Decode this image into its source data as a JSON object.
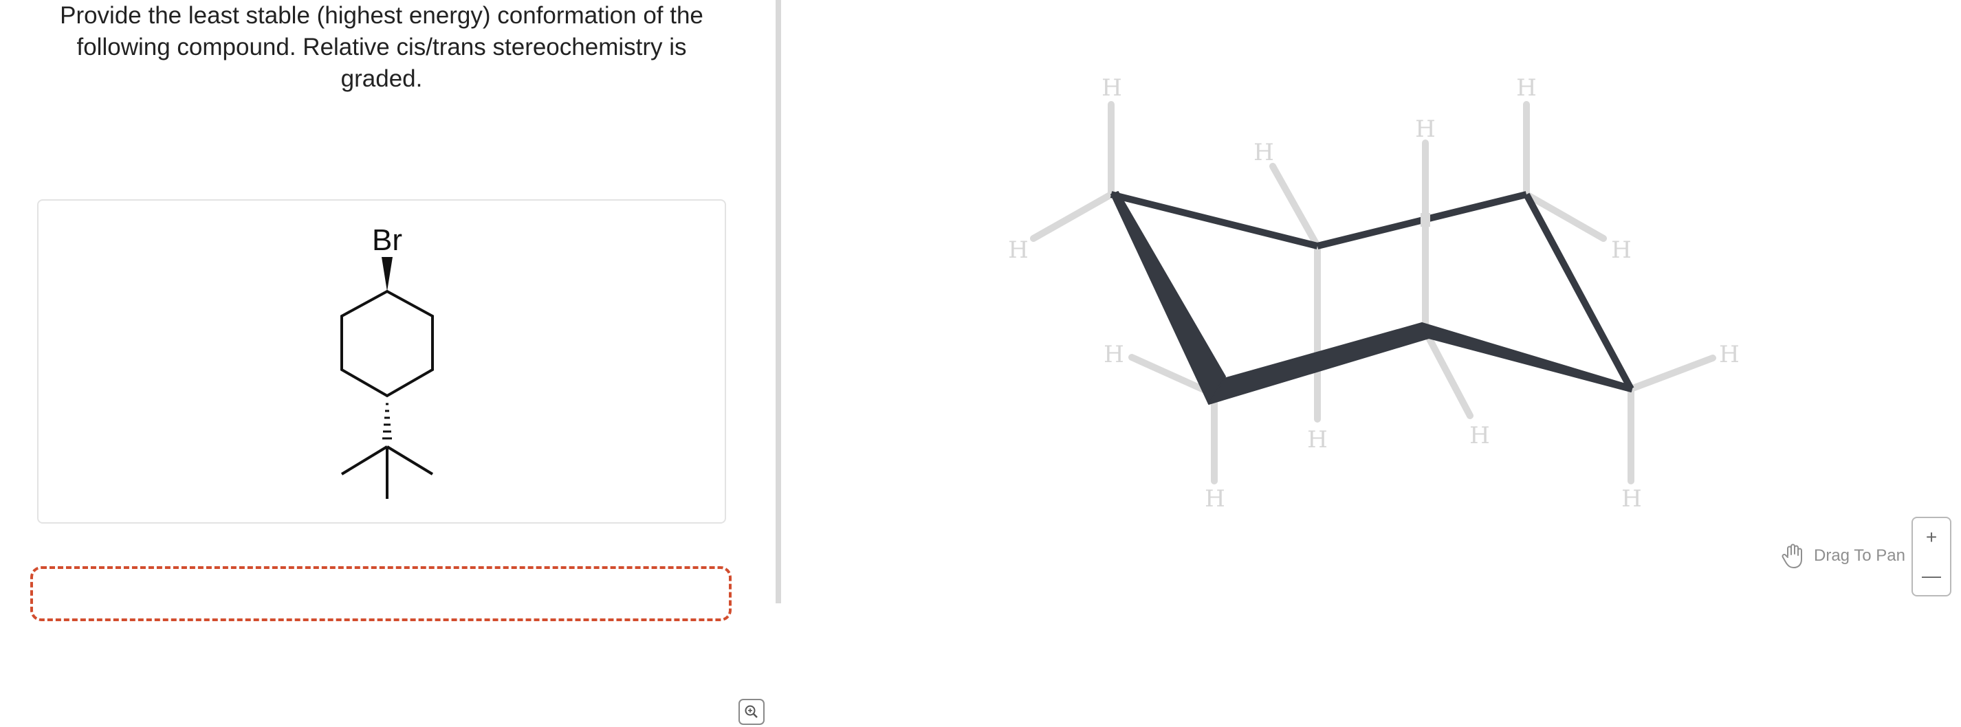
{
  "question": {
    "line1": "Provide the least stable (highest energy) conformation of the",
    "line2": "following compound. Relative cis/trans stereochemistry is",
    "line3": "graded."
  },
  "structure": {
    "substituent_label": "Br",
    "zoom_icon": "magnifier-icon"
  },
  "chair": {
    "h_label": "H",
    "bond_color": "#363a42",
    "hydrogen_color": "#d9d9d9"
  },
  "canvas_controls": {
    "pan_label": "Drag To Pan",
    "pan_icon": "hand-icon",
    "zoom_in": "+",
    "zoom_out": "—"
  },
  "colors": {
    "answer_border": "#d24d2e",
    "divider": "#d9d9d9"
  }
}
